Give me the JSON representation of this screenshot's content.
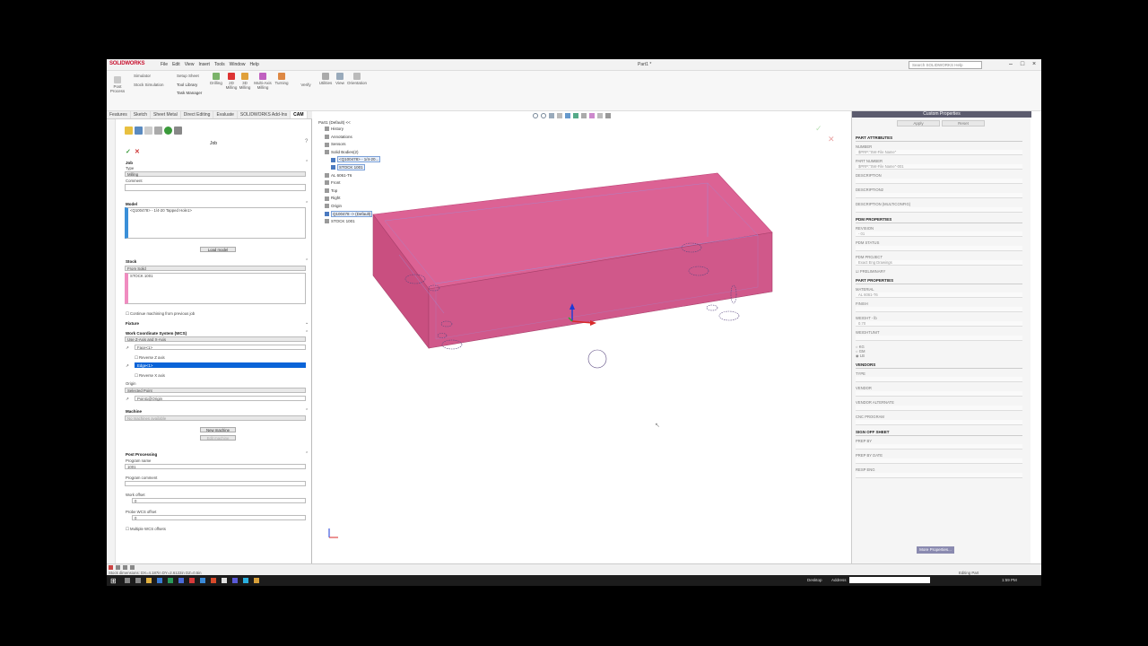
{
  "app": {
    "logo": "SOLIDWORKS",
    "menus": [
      "File",
      "Edit",
      "View",
      "Insert",
      "Tools",
      "Window",
      "Help"
    ],
    "doc_title": "Part1 *",
    "search_placeholder": "Search SOLIDWORKS Help"
  },
  "ribbon": {
    "groups": [
      {
        "label": "Simulator"
      },
      {
        "label": "Setup Sheet"
      },
      {
        "label": "Stock Simulation"
      },
      {
        "label": "Tool Library"
      },
      {
        "label": "Task Manager"
      },
      {
        "label": "Drilling"
      },
      {
        "label": "2D Milling"
      },
      {
        "label": "3D Milling"
      },
      {
        "label": "Multi-Axis Milling"
      },
      {
        "label": "Turning"
      },
      {
        "label": "Utilities"
      },
      {
        "label": "View"
      },
      {
        "label": "Orientation"
      }
    ],
    "small": [
      "Post Process",
      "Verify"
    ]
  },
  "tabs": [
    "Features",
    "Sketch",
    "Sheet Metal",
    "Direct Editing",
    "Evaluate",
    "SOLIDWORKS Add-Ins",
    "CAM"
  ],
  "left": {
    "title": "Job",
    "job": {
      "section": "Job",
      "type_label": "Type",
      "type_value": "Milling",
      "comment_label": "Comment",
      "comment_value": ""
    },
    "model": {
      "section": "Model",
      "item": "<Q100478> - 1/4-20 Tapped Hole1>",
      "load_button": "Load model"
    },
    "stock": {
      "section": "Stock",
      "source": "From Solid",
      "item": "STOCK 1001",
      "continue": "Continue machining from previous job"
    },
    "fixture": {
      "section": "Fixture"
    },
    "wcs": {
      "section": "Work Coordinate System (WCS)",
      "mode": "Use Z-Axis and X-Axis",
      "z_face": "Face<1>",
      "reverse_z": "Reverse Z axis",
      "x_edge": "Edge<1>",
      "reverse_x": "Reverse X axis",
      "origin_label": "Origin",
      "origin_mode": "Selected Point",
      "origin_point": "Point1@Origin"
    },
    "machine": {
      "section": "Machine",
      "value": "No machines available",
      "new_button": "New machine",
      "edit_button": "Edit machine"
    },
    "post": {
      "section": "Post Processing",
      "program_name_label": "Program name",
      "program_name": "1001",
      "program_comment_label": "Program comment",
      "program_comment": "",
      "work_offset_label": "Work offset",
      "work_offset": "0",
      "probe_label": "Probe WCS offset",
      "probe": "0",
      "multiple": "Multiple WCS offsets"
    }
  },
  "tree": {
    "root": "Part1 (Default) <<",
    "items": [
      {
        "label": "History",
        "indent": 1
      },
      {
        "label": "Annotations",
        "indent": 1
      },
      {
        "label": "Sensors",
        "indent": 1
      },
      {
        "label": "Solid Bodies(2)",
        "indent": 1
      },
      {
        "label": "<Q100478> - 1/4-20...",
        "indent": 2
      },
      {
        "label": "STOCK 1001",
        "indent": 2
      },
      {
        "label": "AL 6061-T6",
        "indent": 1
      },
      {
        "label": "Front",
        "indent": 1
      },
      {
        "label": "Top",
        "indent": 1
      },
      {
        "label": "Right",
        "indent": 1
      },
      {
        "label": "Origin",
        "indent": 1
      },
      {
        "label": "Q100478 -> (Default)",
        "indent": 1
      },
      {
        "label": "STOCK 1001",
        "indent": 1
      }
    ]
  },
  "right": {
    "title": "Custom Properties",
    "apply": "Apply",
    "reset": "Reset",
    "part_attributes": {
      "section": "PART ATTRIBUTES",
      "fields": [
        {
          "label": "NUMBER",
          "value": "$PRP:\"SW-File Name\""
        },
        {
          "label": "PART NUMBER",
          "value": "$PRP:\"SW-File Name\"-001"
        },
        {
          "label": "DESCRIPTION",
          "value": ""
        },
        {
          "label": "DESCRIPTION2",
          "value": ""
        },
        {
          "label": "DESCRIPTION (MULTICONFIG)",
          "value": ""
        }
      ]
    },
    "pdm": {
      "section": "PDM PROPERTIES",
      "fields": [
        {
          "label": "REVISION",
          "value": "- 01"
        },
        {
          "label": "PDM STATUS",
          "value": ""
        },
        {
          "label": "PDM PROJECT",
          "value": "Exact Eng Drawings"
        }
      ],
      "preliminary": "PRELIMINARY"
    },
    "part_props": {
      "section": "PART PROPERTIES",
      "fields": [
        {
          "label": "MATERIAL",
          "value": "AL 6061-T6"
        },
        {
          "label": "FINISH",
          "value": ""
        },
        {
          "label": "WEIGHT - lb",
          "value": "0.70"
        },
        {
          "label": "WEIGHTUNIT",
          "value": ""
        }
      ],
      "units": [
        "KG",
        "GM",
        "LB"
      ]
    },
    "vendors": {
      "section": "VENDORS",
      "fields": [
        {
          "label": "TYPE",
          "value": ""
        },
        {
          "label": "VENDOR",
          "value": ""
        },
        {
          "label": "VENDOR ALTERNATE",
          "value": ""
        },
        {
          "label": "CNC PROGRAM",
          "value": ""
        }
      ]
    },
    "signoff": {
      "section": "SIGN OFF SHEET",
      "fields": [
        {
          "label": "PREP BY",
          "value": ""
        },
        {
          "label": "PREP BY DATE",
          "value": ""
        },
        {
          "label": "RESP ENG",
          "value": ""
        }
      ]
    },
    "more": "More Properties..."
  },
  "status": {
    "left": "Stock dimensions: DX=4.187in DY=2.6122in DZ=0.5in",
    "right": "Editing Part"
  },
  "taskbar": {
    "desktop": "Desktop",
    "address": "Address",
    "time": "1:59 PM"
  },
  "colors": {
    "part": "#d6558b",
    "part_top": "#dc6294",
    "part_front": "#c94f80",
    "accent": "#0078d7",
    "panel_head": "#5c5c6e"
  }
}
